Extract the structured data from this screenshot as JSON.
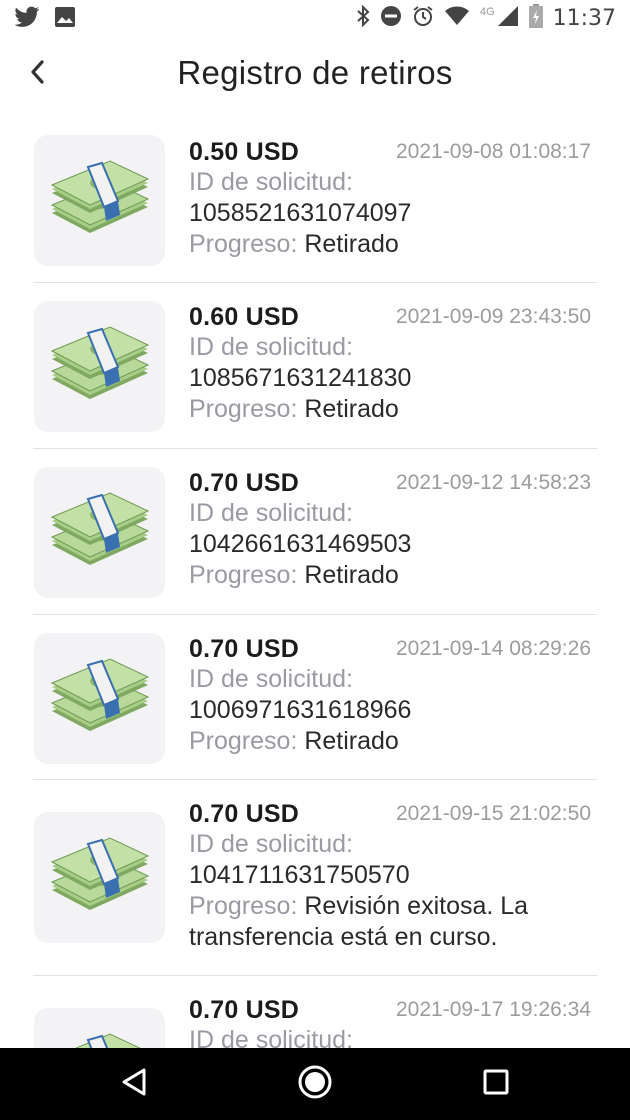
{
  "status_bar": {
    "time": "11:37",
    "network": "4G",
    "left_icons": [
      "twitter-icon",
      "image-icon"
    ],
    "right_icons": [
      "bluetooth-icon",
      "do-not-disturb-icon",
      "alarm-icon",
      "wifi-icon",
      "signal-icon",
      "battery-icon"
    ]
  },
  "header": {
    "title": "Registro de retiros",
    "back_icon": "chevron-left-icon"
  },
  "labels": {
    "request_id": "ID de solicitud:",
    "progress": "Progreso:"
  },
  "withdrawals": [
    {
      "amount": "0.50 USD",
      "date": "2021-09-08 01:08:17",
      "request_id": "1058521631074097",
      "progress": "Retirado",
      "progress_line2": ""
    },
    {
      "amount": "0.60 USD",
      "date": "2021-09-09 23:43:50",
      "request_id": "1085671631241830",
      "progress": "Retirado",
      "progress_line2": ""
    },
    {
      "amount": "0.70 USD",
      "date": "2021-09-12 14:58:23",
      "request_id": "1042661631469503",
      "progress": "Retirado",
      "progress_line2": ""
    },
    {
      "amount": "0.70 USD",
      "date": "2021-09-14 08:29:26",
      "request_id": "1006971631618966",
      "progress": "Retirado",
      "progress_line2": ""
    },
    {
      "amount": "0.70 USD",
      "date": "2021-09-15 21:02:50",
      "request_id": "1041711631750570",
      "progress": "Revisión exitosa. La",
      "progress_line2": "transferencia está en curso."
    },
    {
      "amount": "0.70 USD",
      "date": "2021-09-17 19:26:34",
      "request_id": "",
      "progress": "",
      "progress_line2": ""
    }
  ],
  "nav_bar": {
    "back_icon": "triangle-back-icon",
    "home_icon": "circle-home-icon",
    "recents_icon": "square-recents-icon"
  },
  "colors": {
    "label_gray": "#9a9aa2",
    "text_dark": "#222222",
    "thumb_bg": "#f3f3f6",
    "money_green": "#9cc27a",
    "band_blue": "#3a6fb0"
  }
}
